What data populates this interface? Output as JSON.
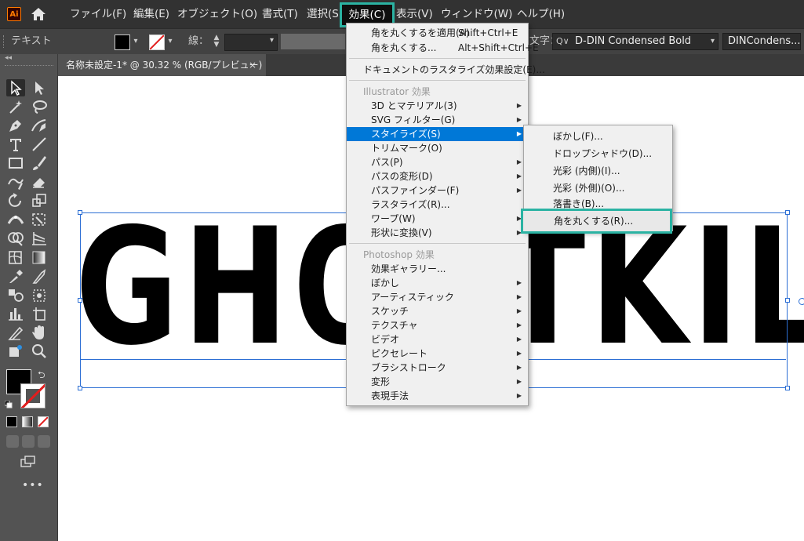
{
  "app": {
    "logo": "Ai"
  },
  "menubar": {
    "items": [
      "ファイル(F)",
      "編集(E)",
      "オブジェクト(O)",
      "書式(T)",
      "選択(S",
      "効果(C)",
      "表示(V)",
      "ウィンドウ(W)",
      "ヘルプ(H)"
    ]
  },
  "controlbar": {
    "tool_label": "テキスト",
    "stroke_label": "線：",
    "char_label": "文字：",
    "font_search_icon": "Q∨",
    "font_family": "D-DIN Condensed Bold",
    "font_style": "DINCondens..."
  },
  "document": {
    "tab_title": "名称未設定-1* @ 30.32 % (RGB/プレビュー)",
    "tab_close": "×",
    "headline": "GHOSTKILLER"
  },
  "effect_menu": {
    "apply_last": {
      "label": "角を丸くするを適用(A)",
      "shortcut": "Shift+Ctrl+E"
    },
    "last_effect": {
      "label": "角を丸くする...",
      "shortcut": "Alt+Shift+Ctrl+E"
    },
    "raster_settings": "ドキュメントのラスタライズ効果設定(E)...",
    "illustrator_header": "Illustrator 効果",
    "illustrator_items": [
      {
        "label": "3D とマテリアル(3)",
        "submenu": true
      },
      {
        "label": "SVG フィルター(G)",
        "submenu": true
      },
      {
        "label": "スタイライズ(S)",
        "submenu": true
      },
      {
        "label": "トリムマーク(O)",
        "submenu": false
      },
      {
        "label": "パス(P)",
        "submenu": true
      },
      {
        "label": "パスの変形(D)",
        "submenu": true
      },
      {
        "label": "パスファインダー(F)",
        "submenu": true
      },
      {
        "label": "ラスタライズ(R)...",
        "submenu": false
      },
      {
        "label": "ワープ(W)",
        "submenu": true
      },
      {
        "label": "形状に変換(V)",
        "submenu": true
      }
    ],
    "photoshop_header": "Photoshop 効果",
    "photoshop_items": [
      {
        "label": "効果ギャラリー...",
        "submenu": false
      },
      {
        "label": "ぼかし",
        "submenu": true
      },
      {
        "label": "アーティスティック",
        "submenu": true
      },
      {
        "label": "スケッチ",
        "submenu": true
      },
      {
        "label": "テクスチャ",
        "submenu": true
      },
      {
        "label": "ビデオ",
        "submenu": true
      },
      {
        "label": "ピクセレート",
        "submenu": true
      },
      {
        "label": "ブラシストローク",
        "submenu": true
      },
      {
        "label": "変形",
        "submenu": true
      },
      {
        "label": "表現手法",
        "submenu": true
      }
    ],
    "arrow": "▶"
  },
  "stylize_menu": {
    "items": [
      "ぼかし(F)...",
      "ドロップシャドウ(D)...",
      "光彩 (内側)(I)...",
      "光彩 (外側)(O)...",
      "落書き(B)..."
    ],
    "round_corners": "角を丸くする(R)..."
  },
  "colors": {
    "accent_highlight": "#2bb3a3",
    "menu_selection": "#0078d7",
    "selection_blue": "#2d6fd4"
  }
}
